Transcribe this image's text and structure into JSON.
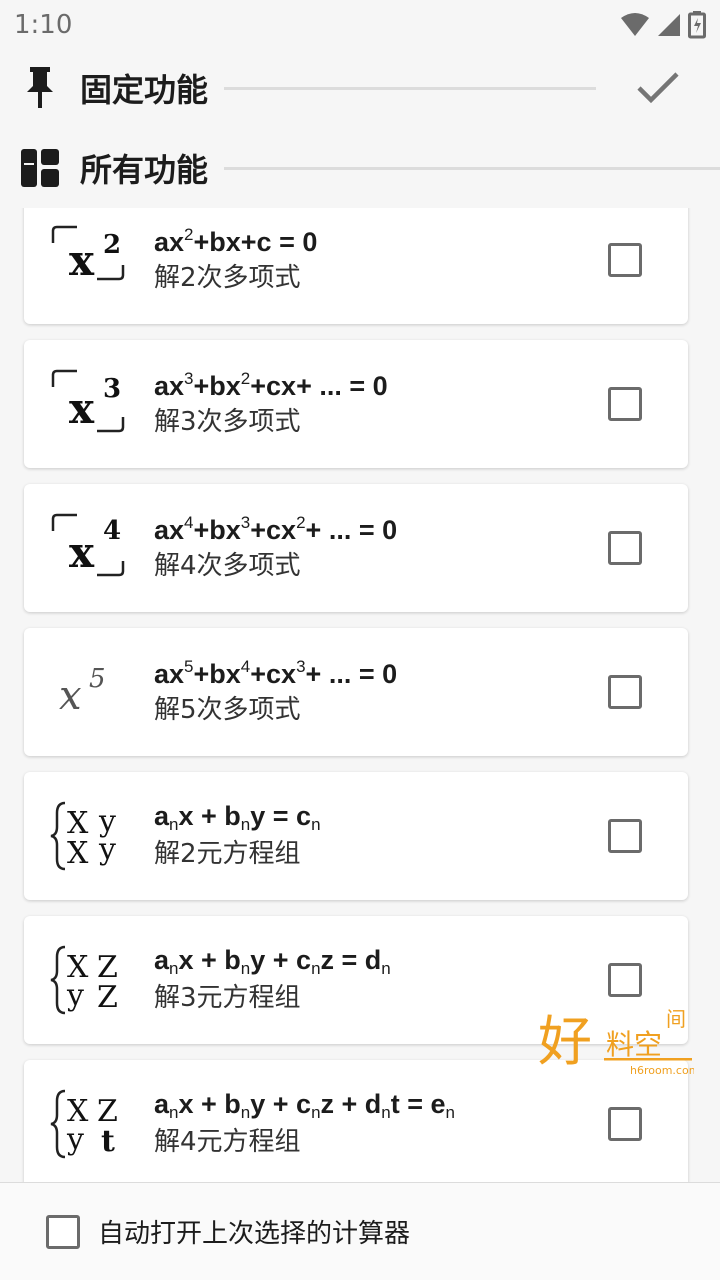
{
  "status_bar": {
    "time": "1:10"
  },
  "pinned": {
    "title": "固定功能",
    "confirm_icon": "check-icon"
  },
  "all": {
    "title": "所有功能"
  },
  "items": [
    {
      "formula_html": "ax<sup>2</sup>+bx+c = 0",
      "desc": "解2次多项式",
      "icon": "quadratic-icon",
      "checked": false
    },
    {
      "formula_html": "ax<sup>3</sup>+bx<sup>2</sup>+cx+ ... = 0",
      "desc": "解3次多项式",
      "icon": "cubic-icon",
      "checked": false
    },
    {
      "formula_html": "ax<sup>4</sup>+bx<sup>3</sup>+cx<sup>2</sup>+ ... = 0",
      "desc": "解4次多项式",
      "icon": "quartic-icon",
      "checked": false
    },
    {
      "formula_html": "ax<sup>5</sup>+bx<sup>4</sup>+cx<sup>3</sup>+ ... = 0",
      "desc": "解5次多项式",
      "icon": "quintic-icon",
      "checked": false
    },
    {
      "formula_html": "a<sub>n</sub>x + b<sub>n</sub>y = c<sub>n</sub>",
      "desc": "解2元方程组",
      "icon": "system-2-icon",
      "checked": false
    },
    {
      "formula_html": "a<sub>n</sub>x + b<sub>n</sub>y + c<sub>n</sub>z = d<sub>n</sub>",
      "desc": "解3元方程组",
      "icon": "system-3-icon",
      "checked": false
    },
    {
      "formula_html": "a<sub>n</sub>x + b<sub>n</sub>y + c<sub>n</sub>z + d<sub>n</sub>t = e<sub>n</sub>",
      "desc": "解4元方程组",
      "icon": "system-4-icon",
      "checked": false
    }
  ],
  "watermark": {
    "main": "好",
    "sub": "料空",
    "corner": "间",
    "url": "h6room.com"
  },
  "bottom": {
    "label": "自动打开上次选择的计算器",
    "checked": false
  },
  "colors": {
    "background": "#f6f6f6",
    "card": "#ffffff",
    "divider": "#dcdcdc",
    "watermark": "#f0a020"
  }
}
